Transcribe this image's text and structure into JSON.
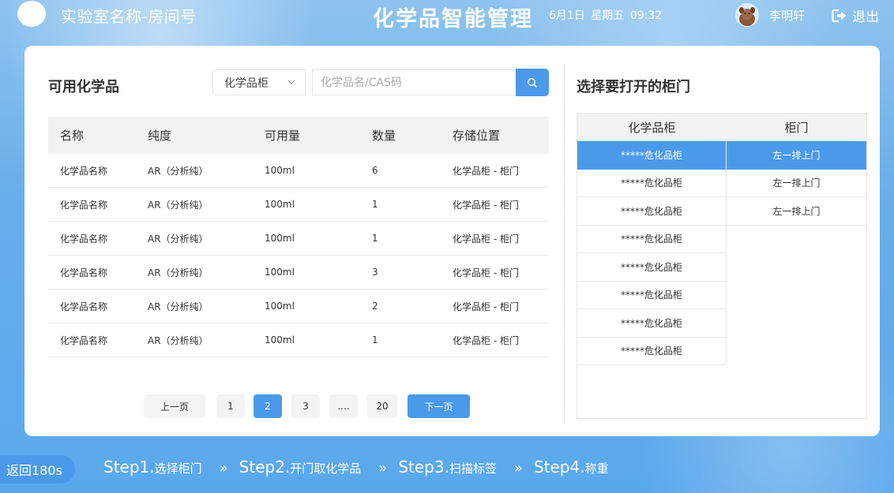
{
  "header": {
    "lab_name": "实验室名称-房间号",
    "app_title": "化学品智能管理",
    "datetime": "6月1日  星期五  09:32",
    "user_name": "李明轩",
    "logout_label": "退出"
  },
  "left": {
    "title": "可用化学品",
    "filter_value": "化学品柜",
    "search_placeholder": "化学品名/CAS码",
    "columns": [
      "名称",
      "纯度",
      "可用量",
      "数量",
      "存储位置"
    ],
    "rows": [
      [
        "化学品名称",
        "AR（分析纯）",
        "100ml",
        "6",
        "化学品柜 - 柜门"
      ],
      [
        "化学品名称",
        "AR（分析纯）",
        "100ml",
        "1",
        "化学品柜 - 柜门"
      ],
      [
        "化学品名称",
        "AR（分析纯）",
        "100ml",
        "1",
        "化学品柜 - 柜门"
      ],
      [
        "化学品名称",
        "AR（分析纯）",
        "100ml",
        "3",
        "化学品柜 - 柜门"
      ],
      [
        "化学品名称",
        "AR（分析纯）",
        "100ml",
        "2",
        "化学品柜 - 柜门"
      ],
      [
        "化学品名称",
        "AR（分析纯）",
        "100ml",
        "1",
        "化学品柜 - 柜门"
      ]
    ],
    "pagination": {
      "prev": "上一页",
      "pages": [
        "1",
        "2",
        "3",
        "....",
        "20"
      ],
      "current": "2",
      "next": "下一页"
    }
  },
  "right": {
    "title": "选择要打开的柜门",
    "columns": [
      "化学品柜",
      "柜门"
    ],
    "cabinets": [
      "*****危化品柜",
      "*****危化品柜",
      "*****危化品柜",
      "*****危化品柜",
      "*****危化品柜",
      "*****危化品柜",
      "*****危化品柜",
      "*****危化品柜"
    ],
    "doors": [
      "左一排上门",
      "左一排上门",
      "左一排上门"
    ]
  },
  "footer": {
    "back_label": "返回180s",
    "steps": [
      {
        "main": "Step1.",
        "sub": "选择柜门"
      },
      {
        "main": "Step2.",
        "sub": "开门取化学品"
      },
      {
        "main": "Step3.",
        "sub": "扫描标签"
      },
      {
        "main": "Step4.",
        "sub": "称重"
      }
    ],
    "separator": "»"
  },
  "colors": {
    "accent": "#4b9ae9",
    "background": "#67aeea"
  }
}
